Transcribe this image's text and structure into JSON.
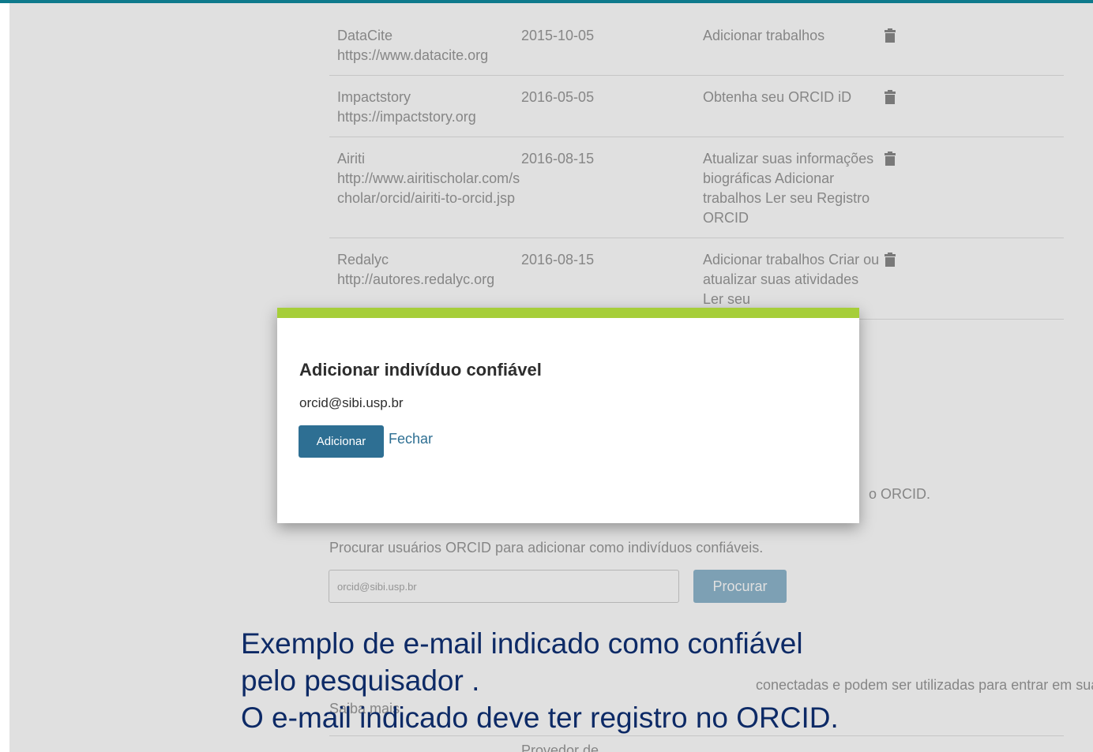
{
  "apps": [
    {
      "name": "DataCite",
      "url": "https://www.datacite.org",
      "date": "2015-10-05",
      "permissions": "Adicionar trabalhos"
    },
    {
      "name": "Impactstory",
      "url": "https://impactstory.org",
      "date": "2016-05-05",
      "permissions": "Obtenha seu ORCID iD"
    },
    {
      "name": "Airiti",
      "url": "http://www.airitischolar.com/scholar/orcid/airiti-to-orcid.jsp",
      "date": "2016-08-15",
      "permissions": "Atualizar suas informações biográficas Adicionar trabalhos Ler seu Registro ORCID"
    },
    {
      "name": "Redalyc",
      "url": "http://autores.redalyc.org",
      "date": "2016-08-15",
      "permissions": "Adicionar trabalhos Criar ou atualizar suas atividades Ler seu"
    }
  ],
  "trusted": {
    "note_fragment": "o ORCID.",
    "search_intro": "Procurar usuários ORCID para adicionar como indivíduos confiáveis.",
    "search_value": "orcid@sibi.usp.br",
    "search_button": "Procurar"
  },
  "alt_signin": {
    "text": "conectadas e podem ser utilizadas para entrar em sua conta ORCID.",
    "learn_more": "Saiba mais",
    "col_provider": "Provedor de"
  },
  "modal": {
    "title": "Adicionar indivíduo confiável",
    "email": "orcid@sibi.usp.br",
    "add_button": "Adicionar",
    "close_link": "Fechar"
  },
  "caption": {
    "line1": "Exemplo de e-mail indicado como confiável",
    "line2": "pelo pesquisador .",
    "line3": "O e-mail indicado deve ter registro no ORCID."
  },
  "colors": {
    "accent_bar": "#a6ce39",
    "primary_button": "#2e6f93",
    "caption_text": "#0d2a66",
    "top_line": "#0e7a8c"
  }
}
